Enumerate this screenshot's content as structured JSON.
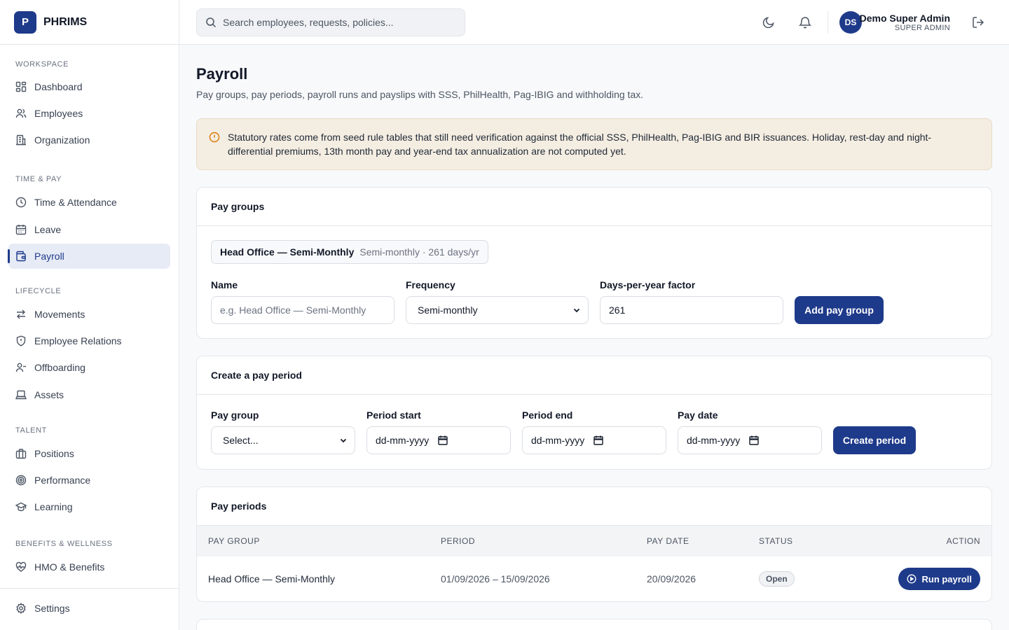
{
  "app": {
    "logo_letter": "P",
    "name": "PHRIMS"
  },
  "search": {
    "placeholder": "Search employees, requests, policies..."
  },
  "user": {
    "initials": "DS",
    "name": "Demo Super Admin",
    "role": "SUPER ADMIN"
  },
  "sidebar": {
    "workspace_label": "WORKSPACE",
    "time_pay_label": "TIME & PAY",
    "lifecycle_label": "LIFECYCLE",
    "talent_label": "TALENT",
    "benefits_label": "BENEFITS & WELLNESS",
    "dashboard": "Dashboard",
    "employees": "Employees",
    "organization": "Organization",
    "time_attendance": "Time & Attendance",
    "leave": "Leave",
    "payroll": "Payroll",
    "movements": "Movements",
    "employee_relations": "Employee Relations",
    "offboarding": "Offboarding",
    "assets": "Assets",
    "positions": "Positions",
    "performance": "Performance",
    "learning": "Learning",
    "hmo_benefits": "HMO & Benefits",
    "settings": "Settings"
  },
  "page": {
    "title": "Payroll",
    "subtitle": "Pay groups, pay periods, payroll runs and payslips with SSS, PhilHealth, Pag-IBIG and withholding tax.",
    "alert": "Statutory rates come from seed rule tables that still need verification against the official SSS, PhilHealth, Pag-IBIG and BIR issuances. Holiday, rest-day and night-differential premiums, 13th month pay and year-end tax annualization are not computed yet."
  },
  "pay_groups": {
    "title": "Pay groups",
    "existing": {
      "name": "Head Office — Semi-Monthly",
      "detail": "Semi-monthly · 261 days/yr"
    },
    "name_label": "Name",
    "name_placeholder": "e.g. Head Office — Semi-Monthly",
    "frequency_label": "Frequency",
    "frequency_value": "Semi-monthly",
    "factor_label": "Days-per-year factor",
    "factor_value": "261",
    "add_button": "Add pay group"
  },
  "create_period": {
    "title": "Create a pay period",
    "pay_group_label": "Pay group",
    "pay_group_value": "Select...",
    "start_label": "Period start",
    "end_label": "Period end",
    "pay_date_label": "Pay date",
    "date_placeholder": "dd-mm-yyyy",
    "create_button": "Create period"
  },
  "pay_periods": {
    "title": "Pay periods",
    "columns": {
      "pay_group": "PAY GROUP",
      "period": "PERIOD",
      "pay_date": "PAY DATE",
      "status": "STATUS",
      "action": "ACTION"
    },
    "rows": [
      {
        "pay_group": "Head Office — Semi-Monthly",
        "period": "01/09/2026 – 15/09/2026",
        "pay_date": "20/09/2026",
        "status": "Open",
        "action": "Run payroll"
      }
    ]
  }
}
